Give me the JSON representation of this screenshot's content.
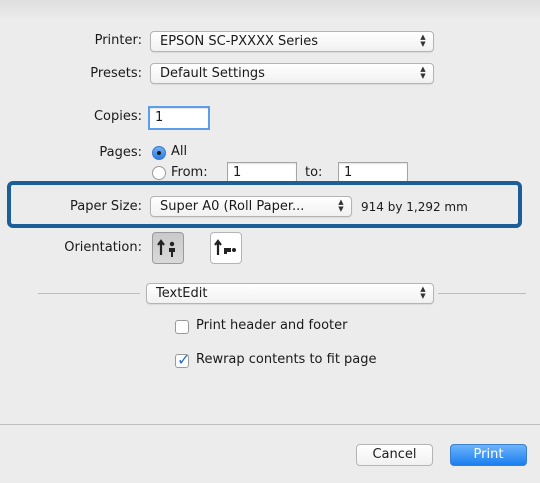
{
  "printer": {
    "label": "Printer:",
    "value": "EPSON SC-PXXXX Series"
  },
  "presets": {
    "label": "Presets:",
    "value": "Default Settings"
  },
  "copies": {
    "label": "Copies:",
    "value": "1"
  },
  "pages": {
    "label": "Pages:",
    "all_label": "All",
    "from_label": "From:",
    "from_value": "1",
    "to_label": "to:",
    "to_value": "1"
  },
  "paper_size": {
    "label": "Paper Size:",
    "value": "Super A0 (Roll Paper...",
    "dimensions": "914 by 1,292 mm"
  },
  "orientation": {
    "label": "Orientation:"
  },
  "section": {
    "value": "TextEdit"
  },
  "options": {
    "print_header": "Print header and footer",
    "rewrap": "Rewrap contents to fit page"
  },
  "buttons": {
    "cancel": "Cancel",
    "print": "Print"
  },
  "colors": {
    "accent": "#1b7ff0",
    "highlight": "#1d5d98"
  }
}
